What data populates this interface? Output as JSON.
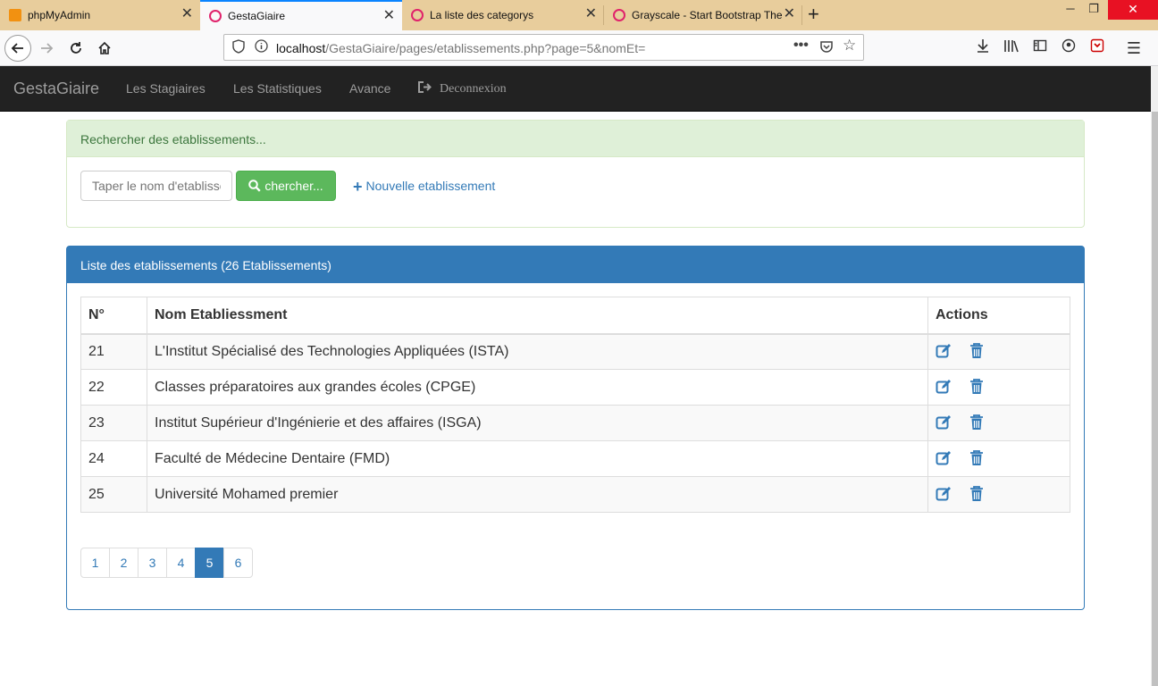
{
  "browser": {
    "tabs": [
      {
        "title": "phpMyAdmin",
        "active": false,
        "icon": "pma-icon"
      },
      {
        "title": "GestaGiaire",
        "active": true,
        "icon": "wamp-icon"
      },
      {
        "title": "La liste des categorys",
        "active": false,
        "icon": "wamp-icon"
      },
      {
        "title": "Grayscale - Start Bootstrap The",
        "active": false,
        "icon": "wamp-icon"
      }
    ],
    "url_host": "localhost",
    "url_path": "/GestaGiaire/pages/etablissements.php?page=5&nomEt="
  },
  "navbar": {
    "brand": "GestaGiaire",
    "links": [
      "Les Stagiaires",
      "Les Statistiques",
      "Avance"
    ],
    "logout": "Deconnexion"
  },
  "search_panel": {
    "heading": "Rechercher des etablissements...",
    "placeholder": "Taper le nom d'etablissement",
    "button_label": "chercher...",
    "new_link": "Nouvelle etablissement"
  },
  "list_panel": {
    "heading": "Liste des etablissements (26 Etablissements)",
    "columns": [
      "N°",
      "Nom Etabliessment",
      "Actions"
    ],
    "rows": [
      {
        "num": "21",
        "name": "L'Institut Spécialisé des Technologies Appliquées (ISTA)"
      },
      {
        "num": "22",
        "name": "Classes préparatoires aux grandes écoles (CPGE)"
      },
      {
        "num": "23",
        "name": "Institut Supérieur d'Ingénierie et des affaires (ISGA)"
      },
      {
        "num": "24",
        "name": "Faculté de Médecine Dentaire (FMD)"
      },
      {
        "num": "25",
        "name": "Université Mohamed premier"
      }
    ]
  },
  "pagination": {
    "pages": [
      "1",
      "2",
      "3",
      "4",
      "5",
      "6"
    ],
    "current": "5"
  },
  "colors": {
    "primary": "#337ab7",
    "success_btn": "#5cb85c",
    "success_panel_bg": "#dff0d8",
    "navbar_bg": "#222222"
  }
}
